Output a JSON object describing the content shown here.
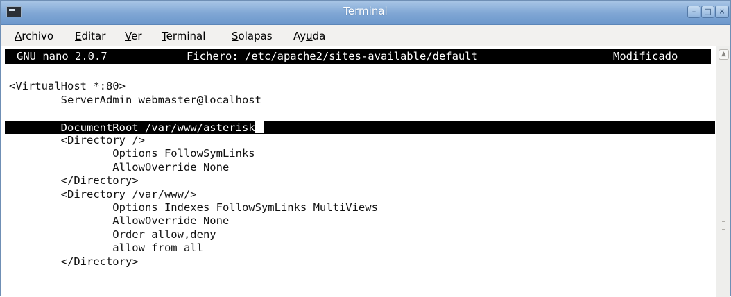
{
  "window": {
    "title": "Terminal",
    "controls": {
      "minimize": "–",
      "maximize": "□",
      "close": "×"
    }
  },
  "menu": [
    {
      "first": "A",
      "rest": "rchivo"
    },
    {
      "first": "E",
      "rest": "ditar"
    },
    {
      "first": "V",
      "rest": "er"
    },
    {
      "first": "T",
      "rest": "erminal"
    },
    {
      "first": "S",
      "rest": "olapas"
    },
    {
      "first": "Ay",
      "underline": "u",
      "rest": "da"
    }
  ],
  "nano": {
    "version": "GNU nano 2.0.7",
    "file": "Fichero: /etc/apache2/sites-available/default",
    "status": "Modificado"
  },
  "lines": [
    "",
    "<VirtualHost *:80>",
    "        ServerAdmin webmaster@localhost",
    "",
    "        DocumentRoot /var/www/asterisk",
    "        <Directory />",
    "                Options FollowSymLinks",
    "                AllowOverride None",
    "        </Directory>",
    "        <Directory /var/www/>",
    "                Options Indexes FollowSymLinks MultiViews",
    "                AllowOverride None",
    "                Order allow,deny",
    "                allow from all",
    "        </Directory>"
  ],
  "highlighted_line_index": 4,
  "icons": {
    "app": "terminal-icon",
    "scroll_up": "arrow-up-icon"
  }
}
